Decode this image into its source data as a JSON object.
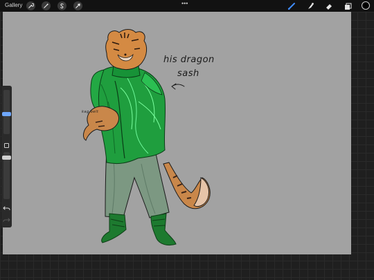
{
  "topbar": {
    "gallery_label": "Gallery",
    "more_dots": "•••",
    "left_tools": [
      "wrench-icon",
      "magic-wand-icon",
      "selection-s-icon",
      "transform-arrow-icon"
    ],
    "right_tools": [
      "brush-icon",
      "smudge-icon",
      "eraser-icon",
      "layers-icon"
    ],
    "active_tool": "brush",
    "active_color": "#000000",
    "accent_color": "#3f8cff"
  },
  "sidebar": {
    "brush_size": 0.6,
    "brush_opacity": 0.9,
    "icons": [
      "modify-square-icon",
      "undo-icon",
      "redo-icon"
    ]
  },
  "canvas": {
    "background": "#a2a2a2",
    "annotation_line1": "his dragon",
    "annotation_line2": "sash",
    "small_note": "kag belt"
  }
}
